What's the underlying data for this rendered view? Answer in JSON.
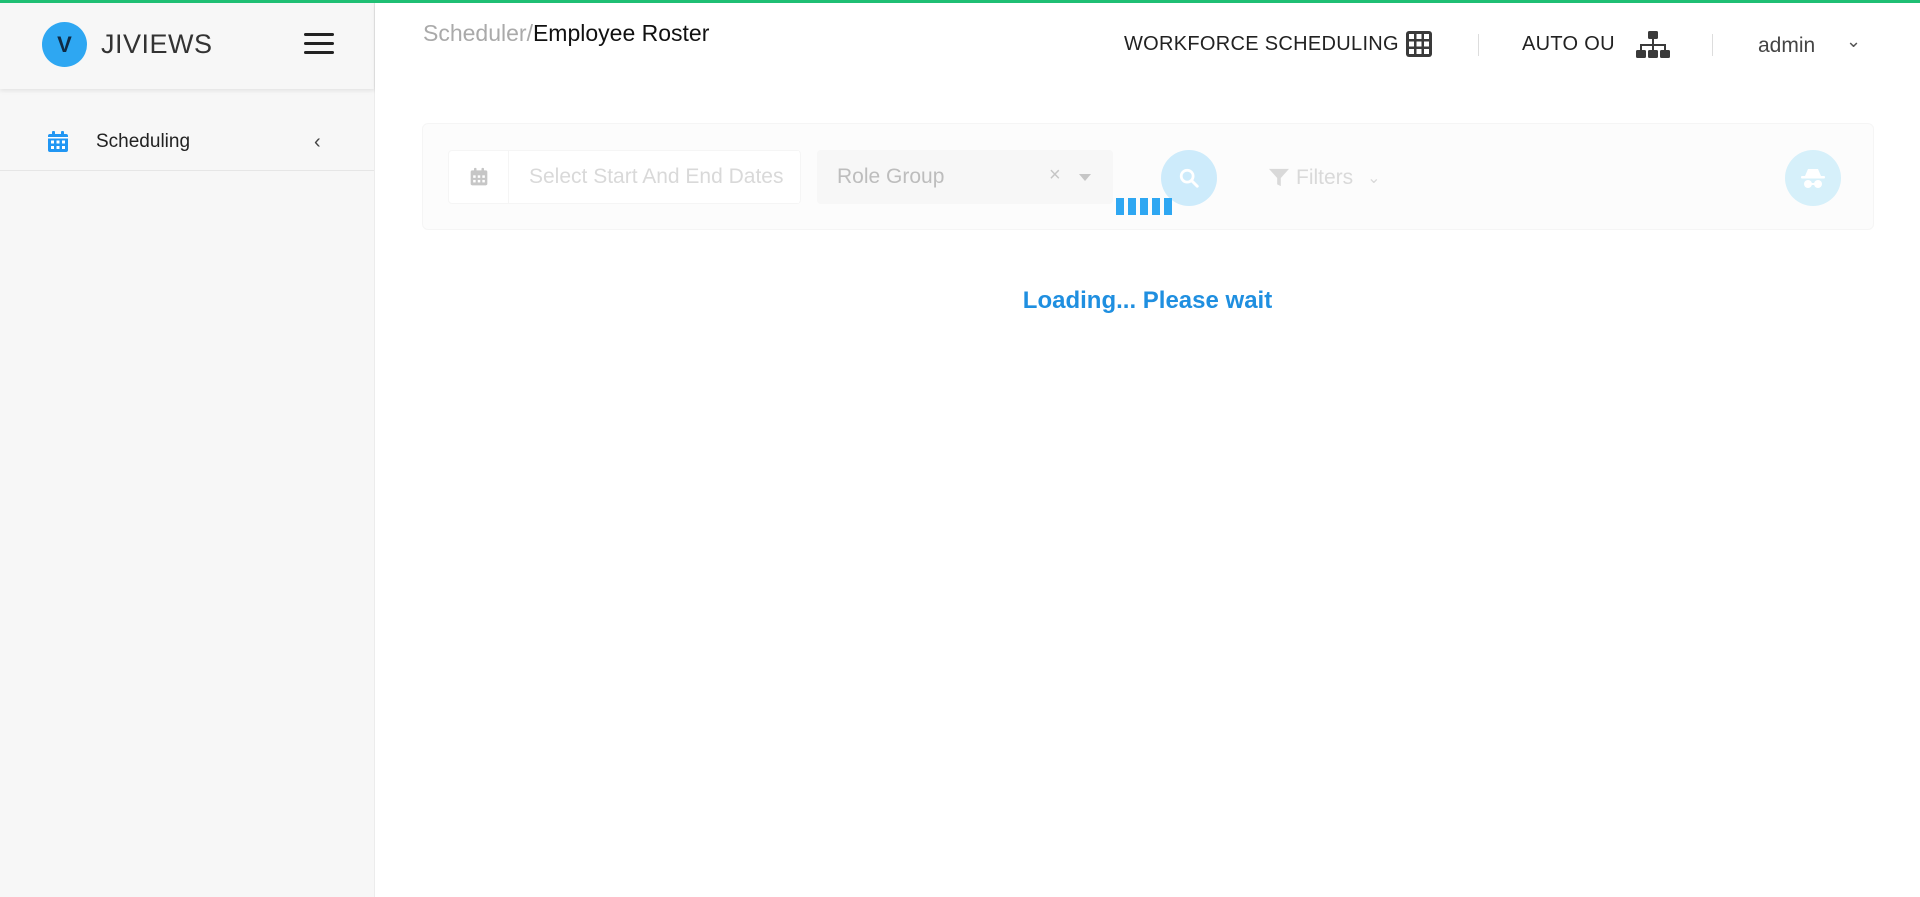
{
  "app": {
    "brand_name": "JIVIEWS",
    "logo_letter": "V"
  },
  "sidebar": {
    "items": [
      {
        "label": "Scheduling",
        "icon": "calendar-icon",
        "expanded": false
      }
    ]
  },
  "header": {
    "breadcrumb_parent": "Scheduler/",
    "breadcrumb_current": "Employee Roster",
    "workforce_label": "WORKFORCE SCHEDULING",
    "workforce_icon": "grid-icon",
    "auto_ou_label": "AUTO OU",
    "auto_ou_icon": "org-chart-icon",
    "user": "admin"
  },
  "toolbar": {
    "date_placeholder": "Select Start And End Dates",
    "role_group_value": "Role Group",
    "clear_symbol": "×",
    "filters_label": "Filters"
  },
  "status": {
    "loading_text": "Loading... Please wait"
  },
  "colors": {
    "accent": "#2ea7f2",
    "top_bar": "#1fbf74",
    "loading_text": "#1f8fe0"
  }
}
